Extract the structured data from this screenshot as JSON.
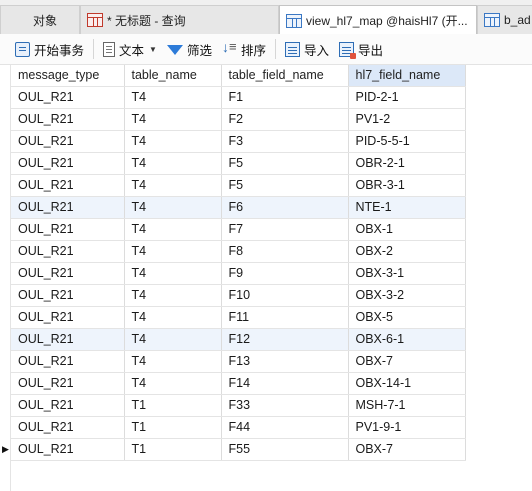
{
  "tabs": [
    {
      "label": "对象",
      "icon": "none"
    },
    {
      "label": "* 无标题 - 查询",
      "icon": "query-icon"
    },
    {
      "label": "view_hl7_map @haisHl7 (开...",
      "icon": "table-grid-icon"
    },
    {
      "label": "b_ad",
      "icon": "table-grid-icon"
    }
  ],
  "toolbar": {
    "begin_transaction": "开始事务",
    "text": "文本",
    "filter": "筛选",
    "sort": "排序",
    "import": "导入",
    "export": "导出"
  },
  "grid": {
    "columns": [
      "message_type",
      "table_name",
      "table_field_name",
      "hl7_field_name"
    ],
    "rows": [
      [
        "OUL_R21",
        "T4",
        "F1",
        "PID-2-1"
      ],
      [
        "OUL_R21",
        "T4",
        "F2",
        "PV1-2"
      ],
      [
        "OUL_R21",
        "T4",
        "F3",
        "PID-5-5-1"
      ],
      [
        "OUL_R21",
        "T4",
        "F5",
        "OBR-2-1"
      ],
      [
        "OUL_R21",
        "T4",
        "F5",
        "OBR-3-1"
      ],
      [
        "OUL_R21",
        "T4",
        "F6",
        "NTE-1"
      ],
      [
        "OUL_R21",
        "T4",
        "F7",
        "OBX-1"
      ],
      [
        "OUL_R21",
        "T4",
        "F8",
        "OBX-2"
      ],
      [
        "OUL_R21",
        "T4",
        "F9",
        "OBX-3-1"
      ],
      [
        "OUL_R21",
        "T4",
        "F10",
        "OBX-3-2"
      ],
      [
        "OUL_R21",
        "T4",
        "F11",
        "OBX-5"
      ],
      [
        "OUL_R21",
        "T4",
        "F12",
        "OBX-6-1"
      ],
      [
        "OUL_R21",
        "T4",
        "F13",
        "OBX-7"
      ],
      [
        "OUL_R21",
        "T4",
        "F14",
        "OBX-14-1"
      ],
      [
        "OUL_R21",
        "T1",
        "F33",
        "MSH-7-1"
      ],
      [
        "OUL_R21",
        "T1",
        "F44",
        "PV1-9-1"
      ],
      [
        "OUL_R21",
        "T1",
        "F55",
        "OBX-7"
      ]
    ],
    "highlighted_column": 3,
    "current_row": 16,
    "alt_rows": [
      5,
      11
    ]
  },
  "colors": {
    "selection": "#dce8f8",
    "row_alt": "#eef4fc",
    "accent": "#2e6db5"
  }
}
